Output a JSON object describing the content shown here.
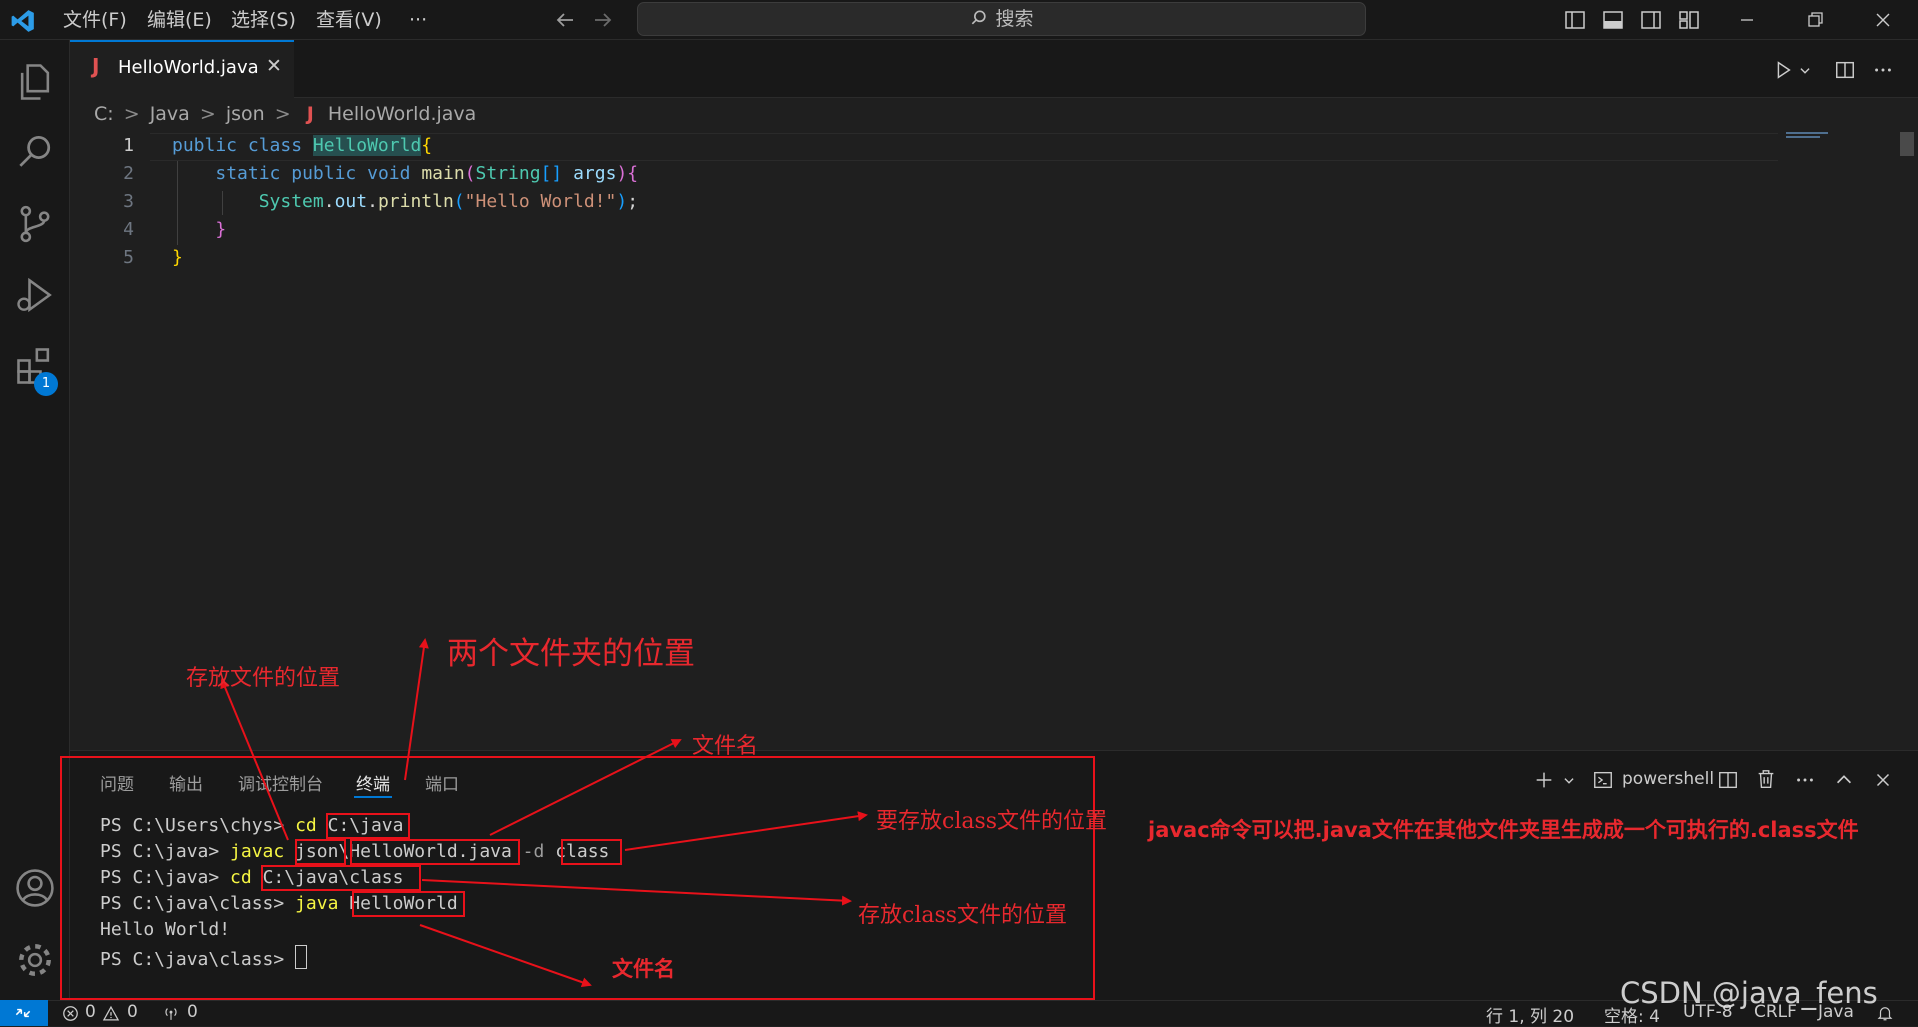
{
  "menu": [
    "文件(F)",
    "编辑(E)",
    "选择(S)",
    "查看(V)",
    "···"
  ],
  "search": {
    "placeholder": "搜索"
  },
  "activity": {
    "extensions_badge": "1"
  },
  "tab": {
    "filename": "HelloWorld.java",
    "icon_letter": "J",
    "close_glyph": "✕"
  },
  "breadcrumb": {
    "drive": "C:",
    "folder1": "Java",
    "folder2": "json",
    "file": "HelloWorld.java"
  },
  "editor": {
    "line_numbers": [
      "1",
      "2",
      "3",
      "4",
      "5"
    ],
    "lines": [
      "public class HelloWorld{",
      "    static public void main(String[] args){",
      "        System.out.println(\"Hello World!\");",
      "    }",
      "}"
    ]
  },
  "panel": {
    "tabs": [
      "问题",
      "输出",
      "调试控制台",
      "终端",
      "端口"
    ],
    "active_tab": "终端",
    "shell_name": "powershell"
  },
  "terminal": {
    "prompt_users": "PS C:\\Users\\chys> ",
    "prompt_java": "PS C:\\java> ",
    "prompt_class": "PS C:\\java\\class> ",
    "cmd_cd": "cd",
    "arg_cjava": "C:\\java",
    "cmd_javac": "javac",
    "arg_json": "json",
    "sep": "\\",
    "arg_hw_java": "HelloWorld.java",
    "flag_d": " -d ",
    "arg_class": "class",
    "arg_cjavaclass": "C:\\java\\class",
    "cmd_java": "java",
    "arg_hw": "HelloWorld",
    "output": "Hello World!"
  },
  "annotations": {
    "two_folders": "两个文件夹的位置",
    "store_file_location": "存放文件的位置",
    "file_name_top": "文件名",
    "class_store_location_1": "要存放class文件的位置",
    "javac_note": "javac命令可以把.java文件在其他文件夹里生成成一个可执行的.class文件",
    "class_store_location_2": "存放class文件的位置",
    "file_name_bottom": "文件名"
  },
  "status": {
    "errors": "0",
    "warnings": "0",
    "ports": "0",
    "position": "行 1, 列 20",
    "spaces": "空格: 4",
    "encoding": "UTF-8",
    "eol": "CRLF",
    "language": "Java",
    "watermark": "CSDN @java_fens"
  },
  "colors": {
    "accent": "#0078d4",
    "annotation_red": "#e8111a"
  }
}
